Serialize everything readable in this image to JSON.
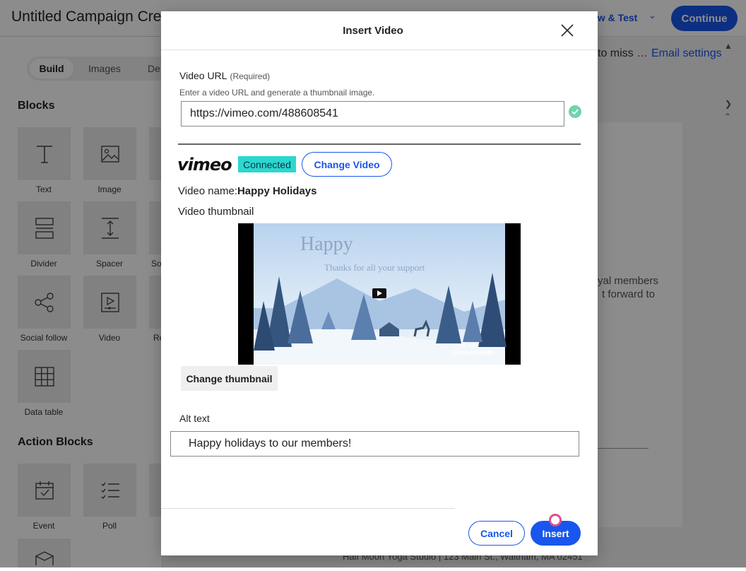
{
  "app": {
    "title": "Untitled Campaign Cre",
    "preview_test_label": "ew & Test",
    "continue_label": "Continue",
    "tabs": {
      "build": "Build",
      "images": "Images",
      "design_cut": "De"
    },
    "notice_text": "to miss …",
    "email_settings_label": "Email settings",
    "blocks_title": "Blocks",
    "blocks": [
      {
        "label": "Text",
        "icon": "text-icon"
      },
      {
        "label": "Image",
        "icon": "image-icon"
      },
      {
        "label": "Divider",
        "icon": "divider-icon"
      },
      {
        "label": "Spacer",
        "icon": "spacer-icon"
      },
      {
        "label": "So",
        "icon": ""
      },
      {
        "label": "Social follow",
        "icon": "share-icon"
      },
      {
        "label": "Video",
        "icon": "video-icon"
      },
      {
        "label": "Re",
        "icon": ""
      },
      {
        "label": "Data table",
        "icon": "table-icon"
      }
    ],
    "action_blocks_title": "Action Blocks",
    "action_blocks": [
      {
        "label": "Event",
        "icon": "calendar-icon"
      },
      {
        "label": "Poll",
        "icon": "list-icon"
      }
    ],
    "canvas_lines": [
      "yal members",
      "t forward to"
    ],
    "footer_text": "Half Moon Yoga Studio | 123 Main St., Waltham, MA 02451"
  },
  "modal": {
    "title": "Insert Video",
    "video_url_label": "Video URL",
    "required_tag": "(Required)",
    "url_help": "Enter a video URL and generate a thumbnail image.",
    "url_value": "https://vimeo.com/488608541",
    "provider_logo": "vimeo",
    "connected_badge": "Connected",
    "change_video_label": "Change Video",
    "video_name_label": "Video name:",
    "video_name_value": "Happy Holidays",
    "video_thumbnail_label": "Video thumbnail",
    "thumbnail": {
      "heading": "Happy",
      "subtext": "Thanks for all your support",
      "watermark_small": "made with",
      "watermark": "vimeocreate"
    },
    "change_thumbnail_label": "Change thumbnail",
    "alt_text_label": "Alt text",
    "alt_text_value": "Happy holidays to our members!",
    "cancel_label": "Cancel",
    "insert_label": "Insert"
  },
  "colors": {
    "accent": "#1856ed",
    "connected": "#2ad8cf",
    "valid_check": "#6fd4a9"
  }
}
